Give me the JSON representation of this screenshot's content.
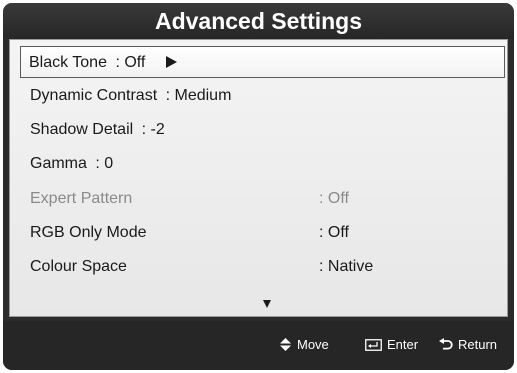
{
  "title": "Advanced Settings",
  "menu": {
    "items": [
      {
        "label": "Black Tone",
        "value": ": Off",
        "has_submenu": true,
        "selected": true
      },
      {
        "label": "Dynamic Contrast",
        "value": ": Medium"
      },
      {
        "label": "Shadow Detail",
        "value": ": -2"
      },
      {
        "label": "Gamma",
        "value": ": 0"
      },
      {
        "label": "Expert Pattern",
        "value": ": Off",
        "disabled": true
      },
      {
        "label": "RGB Only Mode",
        "value": ": Off"
      },
      {
        "label": "Colour Space",
        "value": ": Native"
      }
    ]
  },
  "footer": {
    "move_label": "Move",
    "enter_label": "Enter",
    "return_label": "Return"
  },
  "icons": {
    "submenu": "play-triangle-icon",
    "scroll": "scroll-down-arrow-icon",
    "move": "up-down-arrows-icon",
    "enter": "enter-icon",
    "return": "return-icon"
  }
}
